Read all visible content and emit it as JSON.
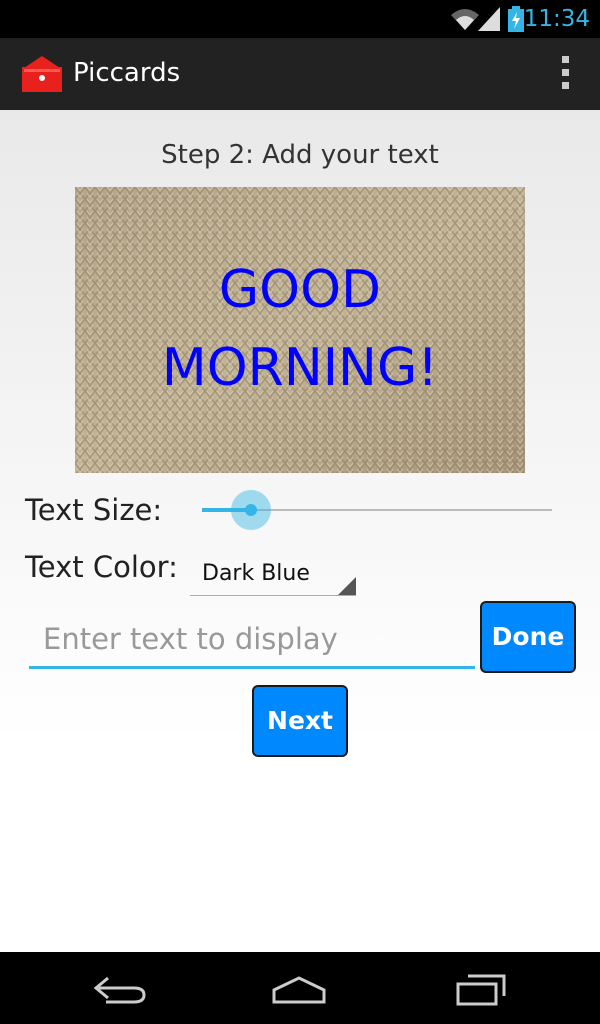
{
  "status": {
    "time": "11:34"
  },
  "app": {
    "title": "Piccards"
  },
  "screen": {
    "step_title": "Step 2: Add your text",
    "preview_text": "GOOD\nMORNING!",
    "preview_color": "#0000ff",
    "text_size_label": "Text Size:",
    "text_size_value": 0.14,
    "text_color_label": "Text Color:",
    "text_color_value": "Dark Blue",
    "input_placeholder": "Enter text to display",
    "done_label": "Done",
    "next_label": "Next"
  },
  "colors": {
    "accent": "#33b5e5",
    "button": "#0088ff",
    "logo": "#e8211c"
  },
  "icons": [
    "wifi-icon",
    "signal-icon",
    "battery-icon",
    "app-logo-icon",
    "overflow-menu-icon",
    "back-icon",
    "home-icon",
    "recent-apps-icon"
  ]
}
